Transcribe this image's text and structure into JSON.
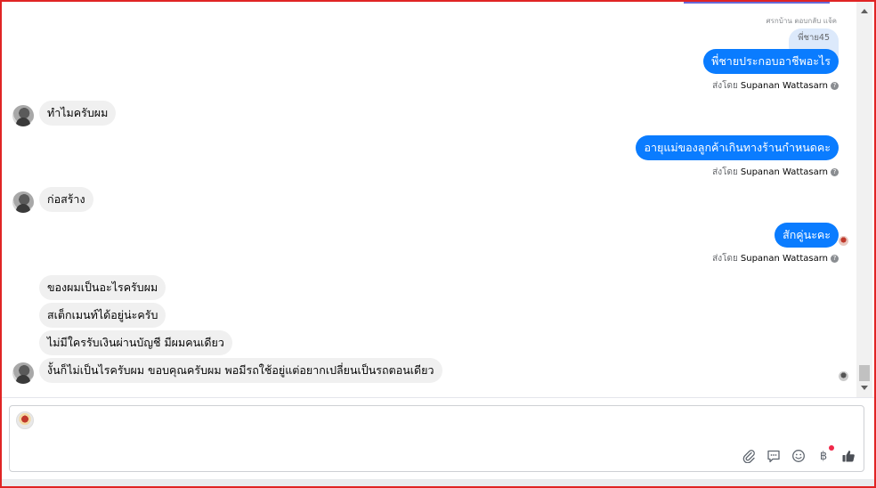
{
  "chat": {
    "top_hint": "ศรกบ้าน ตอบกลับ แจ้ค",
    "reply_quote": "พี่ชาย45",
    "sent_by_prefix": "ส่งโดย",
    "sent_by_name": "Supanan Wattasarn",
    "messages": [
      {
        "dir": "out",
        "text": "พี่ชายประกอบอาชีพอะไร"
      },
      {
        "dir": "in",
        "text": "ทำไมครับผม"
      },
      {
        "dir": "out",
        "text": "อายุแม่ของลูกค้าเกินทางร้านกำหนดคะ"
      },
      {
        "dir": "in",
        "text": "ก่อสร้าง"
      },
      {
        "dir": "out",
        "text": "สักคู่นะคะ"
      },
      {
        "dir": "in",
        "text": "ของผมเป็นอะไรครับผม"
      },
      {
        "dir": "in",
        "text": "สเต็กเมนท์ได้อยู่น่ะครับ"
      },
      {
        "dir": "in",
        "text": "ไม่มีใครรับเงินผ่านบัญชี มีผมคนเดียว"
      },
      {
        "dir": "in",
        "text": "งั้นก็ไม่เป็นไรครับผม ขอบคุณครับผม พอมีรถใช้อยู่แต่อยากเปลี่ยนเป็นรถตอนเดียว"
      }
    ]
  },
  "composer": {
    "placeholder": "",
    "baht_symbol": "฿"
  },
  "colors": {
    "outgoing": "#0a7cff",
    "incoming": "#f0f0f0",
    "frame": "#e02424"
  }
}
